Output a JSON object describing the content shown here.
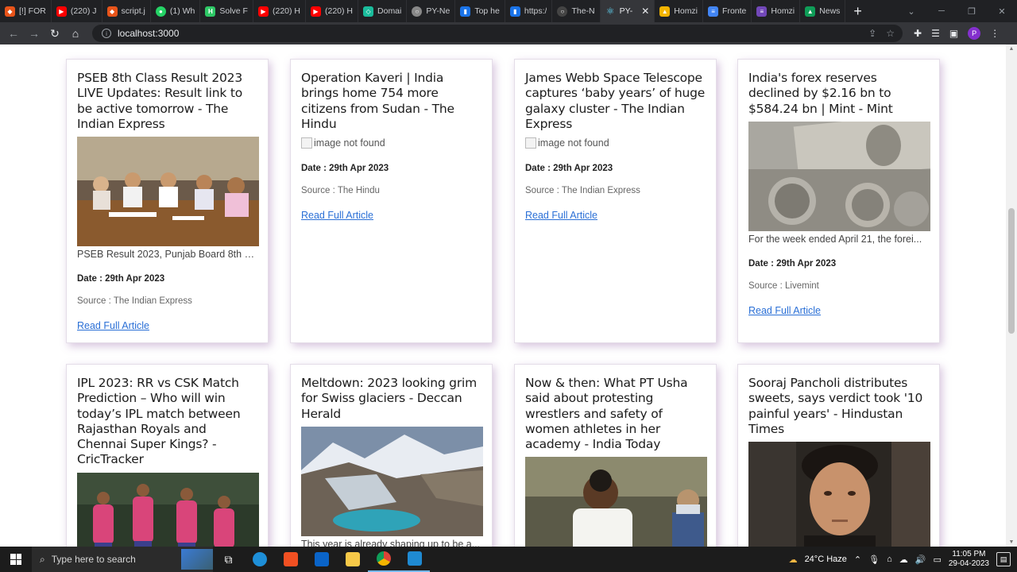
{
  "browser": {
    "tabs": [
      {
        "label": "[!] FOR",
        "color": "#e8541a"
      },
      {
        "label": "(220) J",
        "color": "#ff0000"
      },
      {
        "label": "script.j",
        "color": "#e8541a"
      },
      {
        "label": "(1) Wh",
        "color": "#25d366"
      },
      {
        "label": "Solve F",
        "color": "#2ec866"
      },
      {
        "label": "(220) H",
        "color": "#ff0000"
      },
      {
        "label": "(220) H",
        "color": "#ff0000"
      },
      {
        "label": "Domai",
        "color": "#1abc9c"
      },
      {
        "label": "PY-Ne",
        "color": "#888888"
      },
      {
        "label": "Top he",
        "color": "#1a73e8"
      },
      {
        "label": "https:/",
        "color": "#1a73e8"
      },
      {
        "label": "The-N",
        "color": "#444444"
      },
      {
        "label": "PY-",
        "color": "#61dafb",
        "active": true
      },
      {
        "label": "Homzi",
        "color": "#f4b400"
      },
      {
        "label": "Fronte",
        "color": "#4285f4"
      },
      {
        "label": "Homzi",
        "color": "#7248b9"
      },
      {
        "label": "News",
        "color": "#0f9d58"
      }
    ],
    "new_tab": "+",
    "url": "localhost:3000"
  },
  "articles": [
    {
      "title": "PSEB 8th Class Result 2023 LIVE Updates: Result link to be active tomorrow - The Indian Express",
      "image": "meeting-photo",
      "description": "PSEB Result 2023, Punjab Board 8th Cl...",
      "date": "Date : 29th Apr 2023",
      "source": "Source : The Indian Express",
      "link": "Read Full Article"
    },
    {
      "title": "Operation Kaveri | India brings home 754 more citizens from Sudan - The Hindu",
      "image_alt": "image not found",
      "description": "",
      "date": "Date : 29th Apr 2023",
      "source": "Source : The Hindu",
      "link": "Read Full Article"
    },
    {
      "title": "James Webb Space Telescope captures ‘baby years’ of huge galaxy cluster - The Indian Express",
      "image_alt": "image not found",
      "description": "",
      "date": "Date : 29th Apr 2023",
      "source": "Source : The Indian Express",
      "link": "Read Full Article"
    },
    {
      "title": "India's forex reserves declined by $2.16 bn to $584.24 bn | Mint - Mint",
      "image": "currency-photo",
      "description": "For the week ended April 21, the forei...",
      "date": "Date : 29th Apr 2023",
      "source": "Source : Livemint",
      "link": "Read Full Article"
    },
    {
      "title": "IPL 2023: RR vs CSK Match Prediction – Who will win today’s IPL match between Rajasthan Royals and Chennai Super Kings? - CricTracker",
      "image": "cricket-photo"
    },
    {
      "title": "Meltdown: 2023 looking grim for Swiss glaciers - Deccan Herald",
      "image": "glacier-photo",
      "description": "This year is already shaping up to be a..."
    },
    {
      "title": "Now & then: What PT Usha said about protesting wrestlers and safety of women athletes in her academy - India Today",
      "image": "person-photo"
    },
    {
      "title": "Sooraj Pancholi distributes sweets, says verdict took '10 painful years' - Hindustan Times",
      "image": "portrait-photo"
    }
  ],
  "taskbar": {
    "search_placeholder": "Type here to search",
    "weather": "24°C  Haze",
    "time": "11:05 PM",
    "date": "29-04-2023"
  }
}
